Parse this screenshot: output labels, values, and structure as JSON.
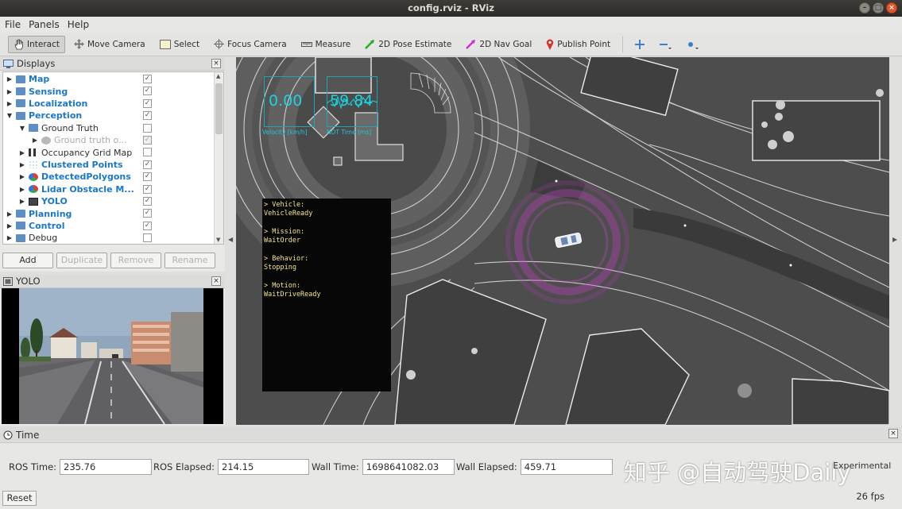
{
  "window": {
    "title": "config.rviz - RViz"
  },
  "menu": {
    "file": "File",
    "panels": "Panels",
    "help": "Help"
  },
  "toolbar": {
    "interact": "Interact",
    "move_camera": "Move Camera",
    "select": "Select",
    "focus_camera": "Focus Camera",
    "measure": "Measure",
    "pose_estimate": "2D Pose Estimate",
    "nav_goal": "2D Nav Goal",
    "publish_point": "Publish Point"
  },
  "displays": {
    "title": "Displays",
    "items": [
      {
        "label": "Map",
        "checked": true,
        "style": "blue",
        "level": 0,
        "expanded": false
      },
      {
        "label": "Sensing",
        "checked": true,
        "style": "blue",
        "level": 0,
        "expanded": false
      },
      {
        "label": "Localization",
        "checked": true,
        "style": "blue",
        "level": 0,
        "expanded": false
      },
      {
        "label": "Perception",
        "checked": true,
        "style": "blue",
        "level": 0,
        "expanded": true
      },
      {
        "label": "Ground Truth",
        "checked": false,
        "style": "normal",
        "level": 1,
        "expanded": true
      },
      {
        "label": "Ground truth o...",
        "checked": true,
        "style": "dim",
        "level": 2,
        "expanded": false
      },
      {
        "label": "Occupancy Grid Map",
        "checked": false,
        "style": "normal",
        "level": 1,
        "expanded": false
      },
      {
        "label": "Clustered Points",
        "checked": true,
        "style": "blue",
        "level": 1,
        "expanded": false
      },
      {
        "label": "DetectedPolygons",
        "checked": true,
        "style": "blue",
        "level": 1,
        "expanded": false
      },
      {
        "label": "Lidar Obstacle M...",
        "checked": true,
        "style": "blue",
        "level": 1,
        "expanded": false
      },
      {
        "label": "YOLO",
        "checked": true,
        "style": "blue",
        "level": 1,
        "expanded": false
      },
      {
        "label": "Planning",
        "checked": true,
        "style": "blue",
        "level": 0,
        "expanded": false
      },
      {
        "label": "Control",
        "checked": true,
        "style": "blue",
        "level": 0,
        "expanded": false
      },
      {
        "label": "Debug",
        "checked": false,
        "style": "normal",
        "level": 0,
        "expanded": false
      }
    ],
    "buttons": {
      "add": "Add",
      "duplicate": "Duplicate",
      "remove": "Remove",
      "rename": "Rename"
    }
  },
  "yolo_panel": {
    "title": "YOLO"
  },
  "viewport": {
    "velocity": {
      "value": "0.00",
      "label": "Velocity [km/h]"
    },
    "ndt_time": {
      "value": "59.84",
      "label": "NDT Time [ms]"
    },
    "status": {
      "vehicle_label": "> Vehicle:",
      "vehicle_value": "VehicleReady",
      "mission_label": "> Mission:",
      "mission_value": "WaitOrder",
      "behavior_label": "> Behavior:",
      "behavior_value": "Stopping",
      "motion_label": "> Motion:",
      "motion_value": "WaitDriveReady"
    }
  },
  "time_panel": {
    "title": "Time",
    "ros_time_label": "ROS Time:",
    "ros_time": "235.76",
    "ros_elapsed_label": "ROS Elapsed:",
    "ros_elapsed": "214.15",
    "wall_time_label": "Wall Time:",
    "wall_time": "1698641082.03",
    "wall_elapsed_label": "Wall Elapsed:",
    "wall_elapsed": "459.71",
    "experimental": "Experimental",
    "reset": "Reset",
    "fps": "26 fps"
  },
  "watermark": "知乎 @自动驾驶Daily"
}
